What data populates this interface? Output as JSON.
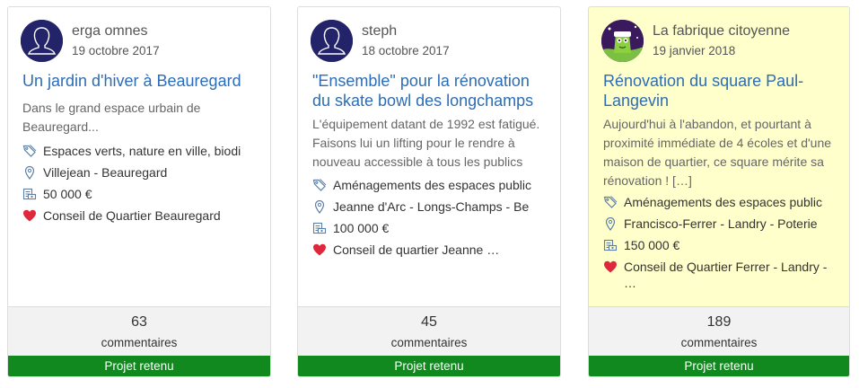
{
  "cards": [
    {
      "author": "erga omnes",
      "date": "19 octobre 2017",
      "title": "Un jardin d'hiver à Beauregard",
      "description": "Dans le grand espace urbain de Beauregard...",
      "theme": "Espaces verts, nature en ville, biodi",
      "location": "Villejean - Beauregard",
      "budget": "50 000 €",
      "supporter": "Conseil de Quartier Beauregard",
      "comments_count": "63",
      "comments_label": "commentaires",
      "status": "Projet retenu",
      "highlighted": false,
      "avatar_icon": "default-user-avatar"
    },
    {
      "author": "steph",
      "date": "18 octobre 2017",
      "title": "\"Ensemble\" pour la rénovation du skate bowl des longchamps",
      "description": "L'équipement datant de 1992 est fatigué. Faisons lui un lifting pour le rendre à nouveau accessible à tous les publics",
      "theme": "Aménagements des espaces public",
      "location": "Jeanne d'Arc - Longs-Champs - Be",
      "budget": "100 000 €",
      "supporter": "Conseil de quartier Jeanne …",
      "comments_count": "45",
      "comments_label": "commentaires",
      "status": "Projet retenu",
      "highlighted": false,
      "avatar_icon": "default-user-avatar"
    },
    {
      "author": "La fabrique citoyenne",
      "date": "19 janvier 2018",
      "title": "Rénovation du square Paul-Langevin",
      "description": "Aujourd'hui à l'abandon, et pourtant à proximité immédiate de 4 écoles et d'une maison de quartier, ce square mérite sa rénovation ! […]",
      "theme": "Aménagements des espaces public",
      "location": "Francisco-Ferrer - Landry - Poterie",
      "budget": "150 000 €",
      "supporter": "Conseil de Quartier Ferrer - Landry - …",
      "comments_count": "189",
      "comments_label": "commentaires",
      "status": "Projet retenu",
      "highlighted": true,
      "avatar_icon": "fabrique-citoyenne-logo"
    }
  ],
  "colors": {
    "title_link": "#2c6db5",
    "status_bg": "#12891f",
    "highlight_bg": "#ffffcc",
    "heart": "#e0283c",
    "icon_line": "#5b7fa6"
  }
}
